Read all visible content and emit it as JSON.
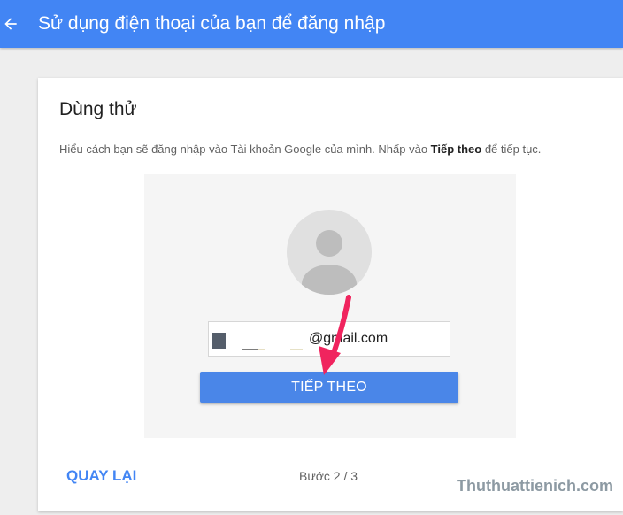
{
  "header": {
    "title": "Sử dụng điện thoại của bạn để đăng nhập",
    "back_icon": "arrow-left-icon"
  },
  "card": {
    "title": "Dùng thử",
    "description_prefix": "Hiểu cách bạn sẽ đăng nhập vào Tài khoản Google của mình. Nhấp vào ",
    "description_bold": "Tiếp theo",
    "description_suffix": " để tiếp tục.",
    "demo": {
      "avatar_icon": "default-avatar-icon",
      "email_value": "@gmail.com",
      "next_button_label": "TIẾP THEO"
    },
    "back_link_label": "QUAY LẠI",
    "step_label": "Bước 2 / 3"
  },
  "watermark": "Thuthuattienich.com",
  "colors": {
    "header_bg": "#4285f4",
    "button_bg": "#4a86e8",
    "link": "#4285f4",
    "arrow": "#f0245e",
    "page_bg": "#eeeeee"
  }
}
